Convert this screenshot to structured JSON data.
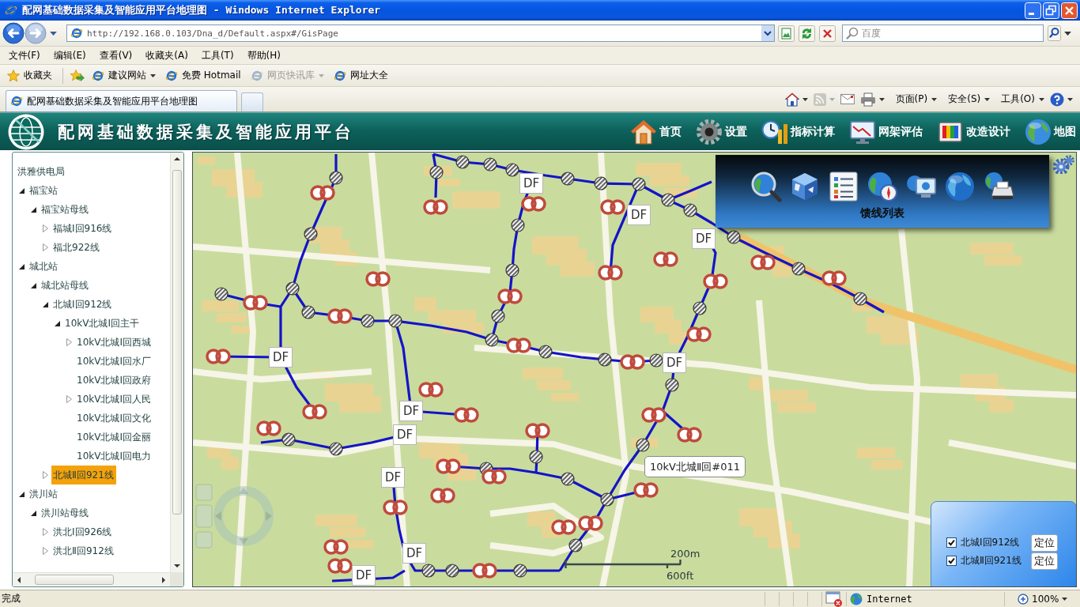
{
  "window": {
    "title": "配网基础数据采集及智能应用平台地理图 - Windows Internet Explorer"
  },
  "address_bar": {
    "url": "http://192.168.0.103/Dna_d/Default.aspx#/GisPage"
  },
  "search": {
    "placeholder": "百度"
  },
  "menu": [
    "文件(F)",
    "编辑(E)",
    "查看(V)",
    "收藏夹(A)",
    "工具(T)",
    "帮助(H)"
  ],
  "favorites_bar": {
    "label": "收藏夹",
    "links": [
      {
        "label": "建议网站",
        "dropdown": true,
        "disabled": false
      },
      {
        "label": "免费 Hotmail",
        "dropdown": false,
        "disabled": false
      },
      {
        "label": "网页快讯库",
        "dropdown": true,
        "disabled": true
      },
      {
        "label": "网址大全",
        "dropdown": false,
        "disabled": false
      }
    ]
  },
  "tabs": [
    {
      "label": "配网基础数据采集及智能应用平台地理图",
      "selected": true
    }
  ],
  "command_bar": {
    "menus": [
      "页面(P)",
      "安全(S)",
      "工具(O)"
    ]
  },
  "app": {
    "title": "配网基础数据采集及智能应用平台",
    "nav": [
      "首页",
      "设置",
      "指标计算",
      "网架评估",
      "改造设计",
      "地图"
    ]
  },
  "tree": {
    "items": [
      {
        "label": "洪雅供电局",
        "selected": false,
        "children": [
          {
            "label": "福宝站",
            "expanded": true,
            "selected": false,
            "children": [
              {
                "label": "福宝站母线",
                "expanded": true,
                "selected": false,
                "children": [
                  {
                    "label": "福城Ⅰ回916线",
                    "expanded": false,
                    "selected": false
                  },
                  {
                    "label": "福北922线",
                    "expanded": false,
                    "selected": false
                  }
                ]
              }
            ]
          },
          {
            "label": "城北站",
            "expanded": true,
            "selected": false,
            "children": [
              {
                "label": "城北站母线",
                "expanded": true,
                "selected": false,
                "children": [
                  {
                    "label": "北城Ⅰ回912线",
                    "expanded": true,
                    "selected": false,
                    "children": [
                      {
                        "label": "10kV北城Ⅰ回主干",
                        "expanded": true,
                        "selected": false,
                        "children": [
                          {
                            "label": "10kV北城Ⅰ回西城",
                            "expanded": false,
                            "selected": false
                          },
                          {
                            "label": "10kV北城Ⅰ回水厂",
                            "selected": false
                          },
                          {
                            "label": "10kV北城Ⅰ回政府",
                            "selected": false
                          },
                          {
                            "label": "10kV北城Ⅰ回人民",
                            "expanded": false,
                            "selected": false
                          },
                          {
                            "label": "10kV北城Ⅰ回文化",
                            "selected": false
                          },
                          {
                            "label": "10kV北城Ⅰ回金丽",
                            "selected": false
                          },
                          {
                            "label": "10kV北城Ⅰ回电力",
                            "selected": false
                          }
                        ]
                      }
                    ]
                  },
                  {
                    "label": "北城Ⅱ回921线",
                    "expanded": false,
                    "selected": true
                  }
                ]
              }
            ]
          },
          {
            "label": "洪川站",
            "expanded": true,
            "selected": false,
            "children": [
              {
                "label": "洪川站母线",
                "expanded": true,
                "selected": false,
                "children": [
                  {
                    "label": "洪北Ⅰ回926线",
                    "expanded": false,
                    "selected": false
                  },
                  {
                    "label": "洪北Ⅱ回912线",
                    "expanded": false,
                    "selected": false
                  }
                ]
              }
            ]
          }
        ]
      }
    ]
  },
  "map": {
    "tool_panel": {
      "caption": "馈线列表"
    },
    "df_markers": [
      "DF",
      "DF",
      "DF",
      "DF",
      "DF",
      "DF",
      "DF",
      "DF",
      "DF",
      "DF"
    ],
    "tooltip": "10kV北城Ⅱ回#011",
    "scale": {
      "metric": "200m",
      "imperial": "600ft"
    },
    "feeder_legend": [
      {
        "label": "北城Ⅰ回912线",
        "checked": true,
        "button": "定位"
      },
      {
        "label": "北城Ⅱ回921线",
        "checked": true,
        "button": "定位"
      }
    ]
  },
  "status_bar": {
    "text": "完成",
    "zone": "Internet",
    "zoom": "100%"
  }
}
